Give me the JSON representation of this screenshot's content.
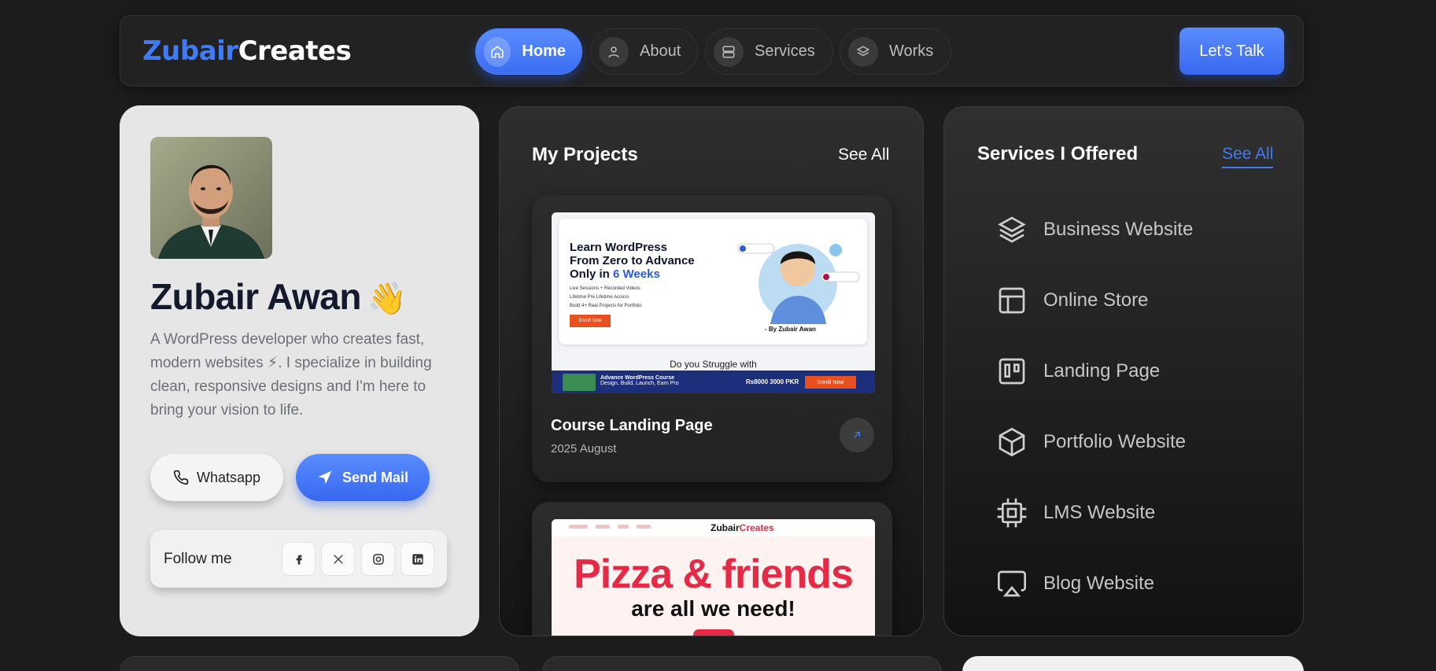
{
  "brand": {
    "part1": "Zubair",
    "part2": "Creates"
  },
  "nav": {
    "items": [
      {
        "label": "Home",
        "icon": "home-icon",
        "active": true
      },
      {
        "label": "About",
        "icon": "user-icon",
        "active": false
      },
      {
        "label": "Services",
        "icon": "server-icon",
        "active": false
      },
      {
        "label": "Works",
        "icon": "layers-icon",
        "active": false
      }
    ],
    "cta": "Let's Talk"
  },
  "profile": {
    "name": "Zubair Awan",
    "emoji": "👋",
    "bio": "A WordPress developer who creates fast, modern websites ⚡. I specialize in building clean, responsive designs and I'm here to bring your vision to life.",
    "whatsapp_label": "Whatsapp",
    "mail_label": "Send Mail",
    "follow_label": "Follow me",
    "socials": [
      "facebook-icon",
      "x-icon",
      "instagram-icon",
      "linkedin-icon"
    ]
  },
  "projects": {
    "title": "My Projects",
    "see_all": "See All",
    "items": [
      {
        "title": "Course Landing Page",
        "date": "2025 August",
        "thumb": {
          "heading_l1": "Learn WordPress",
          "heading_l2": "From Zero to Advance",
          "heading_l3a": "Only in ",
          "heading_l3b": "6 Weeks",
          "bullets": [
            "Live Sessions + Recorded Videos",
            "Lifetime Pre Lifetime Access",
            "Build 4+ Real Projects for Portfolio"
          ],
          "enroll": "Enroll Now",
          "by": "- By Zubair Awan",
          "question": "Do you Struggle with",
          "bar_title": "Advance WordPress Course",
          "bar_sub": "Design, Build, Launch, Earn Pro",
          "bar_price": "Rs8000 3000 PKR",
          "bar_enroll": "Enroll Now"
        }
      },
      {
        "title": "",
        "date": "",
        "thumb": {
          "logo_a": "Zubair",
          "logo_b": "Creates",
          "headline": "Pizza & friends",
          "subline": "are all we need!"
        }
      }
    ]
  },
  "services": {
    "title": "Services I Offered",
    "see_all": "See All",
    "items": [
      {
        "label": "Business Website",
        "icon": "layers-icon"
      },
      {
        "label": "Online Store",
        "icon": "layout-icon"
      },
      {
        "label": "Landing Page",
        "icon": "kanban-icon"
      },
      {
        "label": "Portfolio Website",
        "icon": "box-icon"
      },
      {
        "label": "LMS Website",
        "icon": "cpu-icon"
      },
      {
        "label": "Blog Website",
        "icon": "airplay-icon"
      }
    ]
  },
  "colors": {
    "accent": "#3f7bf5",
    "bg": "#1c1c1c",
    "card_light": "#e6e6e6"
  }
}
